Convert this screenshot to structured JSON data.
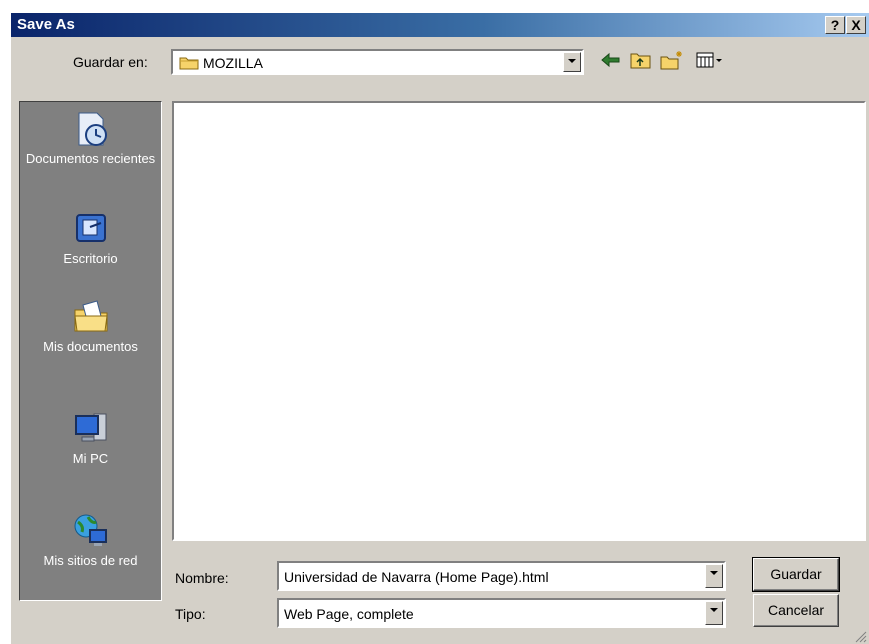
{
  "window": {
    "title": "Save As",
    "help_button": "?",
    "close_button": "X"
  },
  "lookin": {
    "label": "Guardar en:",
    "value": "MOZILLA"
  },
  "places": [
    {
      "label": "Documentos recientes",
      "icon": "recent-documents-icon"
    },
    {
      "label": "Escritorio",
      "icon": "desktop-icon"
    },
    {
      "label": "Mis documentos",
      "icon": "my-documents-icon"
    },
    {
      "label": "Mi PC",
      "icon": "my-computer-icon"
    },
    {
      "label": "Mis sitios de red",
      "icon": "network-places-icon"
    }
  ],
  "filename": {
    "label": "Nombre:",
    "value": "Universidad de Navarra (Home Page).html"
  },
  "filetype": {
    "label": "Tipo:",
    "value": "Web Page, complete"
  },
  "buttons": {
    "save": "Guardar",
    "cancel": "Cancelar"
  },
  "toolbar": [
    "back-icon",
    "up-folder-icon",
    "new-folder-icon",
    "view-menu-icon"
  ],
  "colors": {
    "dialog": "#d4d0c8",
    "titlebar_start": "#0a246a",
    "titlebar_end": "#a6caf0",
    "places_bar": "#808080"
  }
}
